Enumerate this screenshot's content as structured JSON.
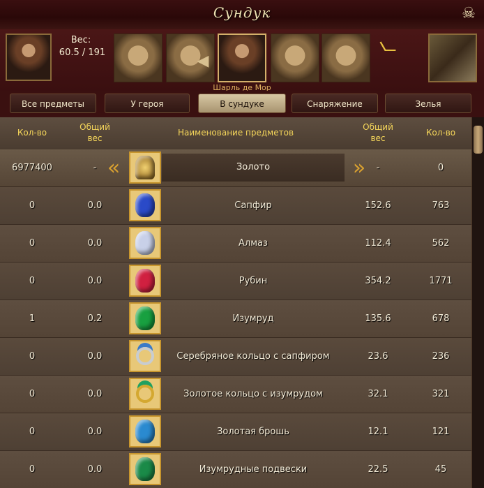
{
  "window": {
    "title": "Сундук"
  },
  "header": {
    "weight_label": "Вес:",
    "weight_value": "60.5 / 191",
    "hero_name": "Шарль де Мор"
  },
  "tabs": [
    {
      "label": "Все предметы",
      "active": false
    },
    {
      "label": "У героя",
      "active": false
    },
    {
      "label": "В сундуке",
      "active": true
    },
    {
      "label": "Снаряжение",
      "active": false
    },
    {
      "label": "Зелья",
      "active": false
    }
  ],
  "table": {
    "headers": {
      "qty_left": "Кол-во",
      "weight_left_1": "Общий",
      "weight_left_2": "вес",
      "name": "Наименование предметов",
      "weight_right_1": "Общий",
      "weight_right_2": "вес",
      "qty_right": "Кол-во"
    },
    "rows": [
      {
        "qty_left": "6977400",
        "weight_left": "-",
        "icon": "gold-coins-icon",
        "name": "Золото",
        "weight_right": "-",
        "qty_right": "0",
        "color": "#c89838"
      },
      {
        "qty_left": "0",
        "weight_left": "0.0",
        "icon": "sapphire-icon",
        "name": "Сапфир",
        "weight_right": "152.6",
        "qty_right": "763",
        "color": "#2a4ac8"
      },
      {
        "qty_left": "0",
        "weight_left": "0.0",
        "icon": "diamond-icon",
        "name": "Алмаз",
        "weight_right": "112.4",
        "qty_right": "562",
        "color": "#c8d0e8"
      },
      {
        "qty_left": "0",
        "weight_left": "0.0",
        "icon": "ruby-icon",
        "name": "Рубин",
        "weight_right": "354.2",
        "qty_right": "1771",
        "color": "#d02040"
      },
      {
        "qty_left": "1",
        "weight_left": "0.2",
        "icon": "emerald-icon",
        "name": "Изумруд",
        "weight_right": "135.6",
        "qty_right": "678",
        "color": "#18a040"
      },
      {
        "qty_left": "0",
        "weight_left": "0.0",
        "icon": "silver-sapphire-ring-icon",
        "name": "Серебряное кольцо с сапфиром",
        "weight_right": "23.6",
        "qty_right": "236",
        "color": "#3a7ac8"
      },
      {
        "qty_left": "0",
        "weight_left": "0.0",
        "icon": "gold-emerald-ring-icon",
        "name": "Золотое кольцо с изумрудом",
        "weight_right": "32.1",
        "qty_right": "321",
        "color": "#20a060"
      },
      {
        "qty_left": "0",
        "weight_left": "0.0",
        "icon": "gold-brooch-icon",
        "name": "Золотая брошь",
        "weight_right": "12.1",
        "qty_right": "121",
        "color": "#2a8ad0"
      },
      {
        "qty_left": "0",
        "weight_left": "0.0",
        "icon": "emerald-pendant-icon",
        "name": "Изумрудные подвески",
        "weight_right": "22.5",
        "qty_right": "45",
        "color": "#1a8a48"
      }
    ]
  }
}
